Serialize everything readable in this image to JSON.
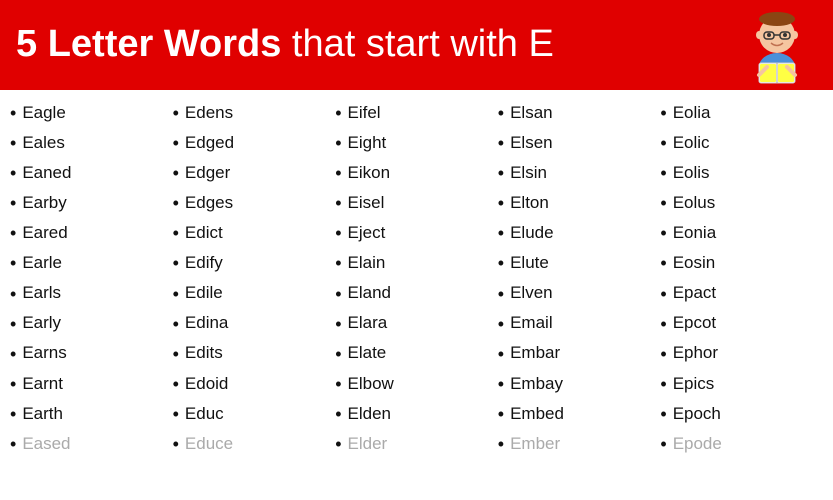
{
  "header": {
    "title_bold": "5 Letter Words",
    "title_normal": " that start with E"
  },
  "columns": [
    {
      "words": [
        "Eagle",
        "Eales",
        "Eaned",
        "Earby",
        "Eared",
        "Earle",
        "Earls",
        "Early",
        "Earns",
        "Earnt",
        "Earth",
        "Eased"
      ]
    },
    {
      "words": [
        "Edens",
        "Edged",
        "Edger",
        "Edges",
        "Edict",
        "Edify",
        "Edile",
        "Edina",
        "Edits",
        "Edoid",
        "Educ",
        "Educe"
      ]
    },
    {
      "words": [
        "Eifel",
        "Eight",
        "Eikon",
        "Eisel",
        "Eject",
        "Elain",
        "Eland",
        "Elara",
        "Elate",
        "Elbow",
        "Elden",
        "Elder"
      ]
    },
    {
      "words": [
        "Elsan",
        "Elsen",
        "Elsin",
        "Elton",
        "Elude",
        "Elute",
        "Elven",
        "Email",
        "Embar",
        "Embay",
        "Embed",
        "Ember"
      ]
    },
    {
      "words": [
        "Eolia",
        "Eolic",
        "Eolis",
        "Eolus",
        "Eonia",
        "Eosin",
        "Epact",
        "Epcot",
        "Ephor",
        "Epics",
        "Epoch",
        "Epode"
      ]
    }
  ],
  "bullet": "•"
}
